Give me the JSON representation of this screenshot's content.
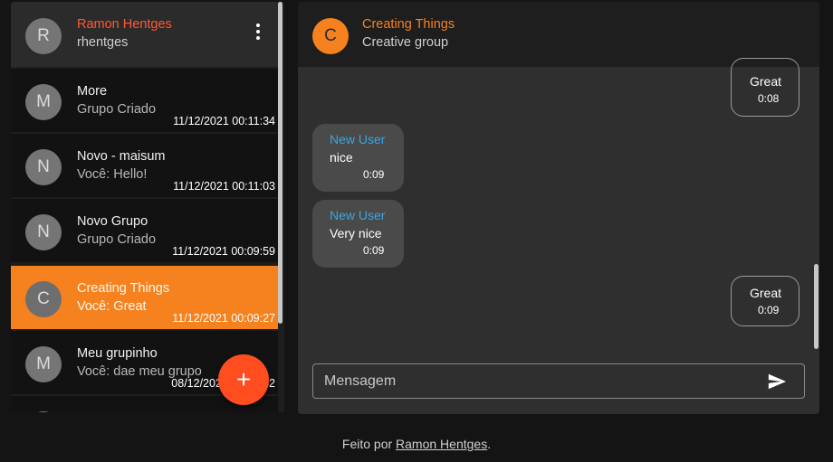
{
  "user": {
    "avatar_letter": "R",
    "name": "Ramon Hentges",
    "handle": "rhentges"
  },
  "chats": [
    {
      "avatar_letter": "M",
      "name": "More",
      "last": "Grupo Criado",
      "time": "11/12/2021 00:11:34",
      "active": false
    },
    {
      "avatar_letter": "N",
      "name": "Novo - maisum",
      "last": "Você: Hello!",
      "time": "11/12/2021 00:11:03",
      "active": false
    },
    {
      "avatar_letter": "N",
      "name": "Novo Grupo",
      "last": "Grupo Criado",
      "time": "11/12/2021 00:09:59",
      "active": false
    },
    {
      "avatar_letter": "C",
      "name": "Creating Things",
      "last": "Você: Great",
      "time": "11/12/2021 00:09:27",
      "active": true
    },
    {
      "avatar_letter": "M",
      "name": "Meu grupinho",
      "last": "Você: dae meu grupo",
      "time": "08/12/2021 00:00:42",
      "active": false
    }
  ],
  "fab_label": "+",
  "conversation": {
    "avatar_letter": "C",
    "name": "Creating Things",
    "subtitle": "Creative group",
    "messages": [
      {
        "direction": "out",
        "text": "Great",
        "time": "0:08"
      },
      {
        "direction": "in",
        "sender": "New User",
        "text": "nice",
        "time": "0:09"
      },
      {
        "direction": "in",
        "sender": "New User",
        "text": "Very nice",
        "time": "0:09"
      },
      {
        "direction": "out",
        "text": "Great",
        "time": "0:09"
      }
    ]
  },
  "composer": {
    "placeholder": "Mensagem",
    "value": ""
  },
  "footer": {
    "prefix": "Feito por ",
    "link": "Ramon Hentges",
    "suffix": "."
  },
  "colors": {
    "accent": "#f5821f",
    "fab": "#ff4d1f",
    "user_name": "#ff5a2e",
    "sender": "#3aa6e0"
  },
  "icons": {
    "menu": "more-vert-icon",
    "add": "add-icon",
    "send": "send-icon"
  }
}
